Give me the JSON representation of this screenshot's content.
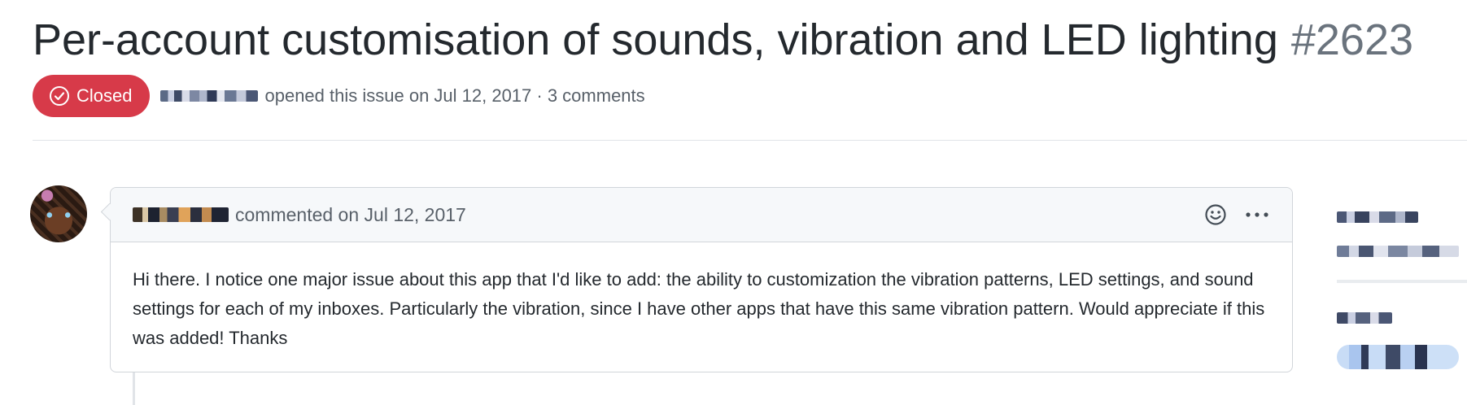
{
  "issue": {
    "title": "Per-account customisation of sounds, vibration and LED lighting",
    "number": "#2623",
    "state": "Closed",
    "meta_text": "opened this issue on Jul 12, 2017 · 3 comments"
  },
  "comment": {
    "date_text": "commented on Jul 12, 2017",
    "body": "Hi there. I notice one major issue about this app that I'd like to add: the ability to customization the vibration patterns, LED settings, and sound settings for each of my inboxes. Particularly the vibration, since I have other apps that have this same vibration pattern. Would appreciate if this was added! Thanks"
  },
  "icons": {
    "state": "check-circle-icon",
    "reaction": "smiley-icon",
    "more": "kebab-horizontal-icon"
  },
  "colors": {
    "closed_badge": "#d73a49",
    "muted_text": "#586069",
    "border": "#d1d5da",
    "header_bg": "#f6f8fa"
  }
}
